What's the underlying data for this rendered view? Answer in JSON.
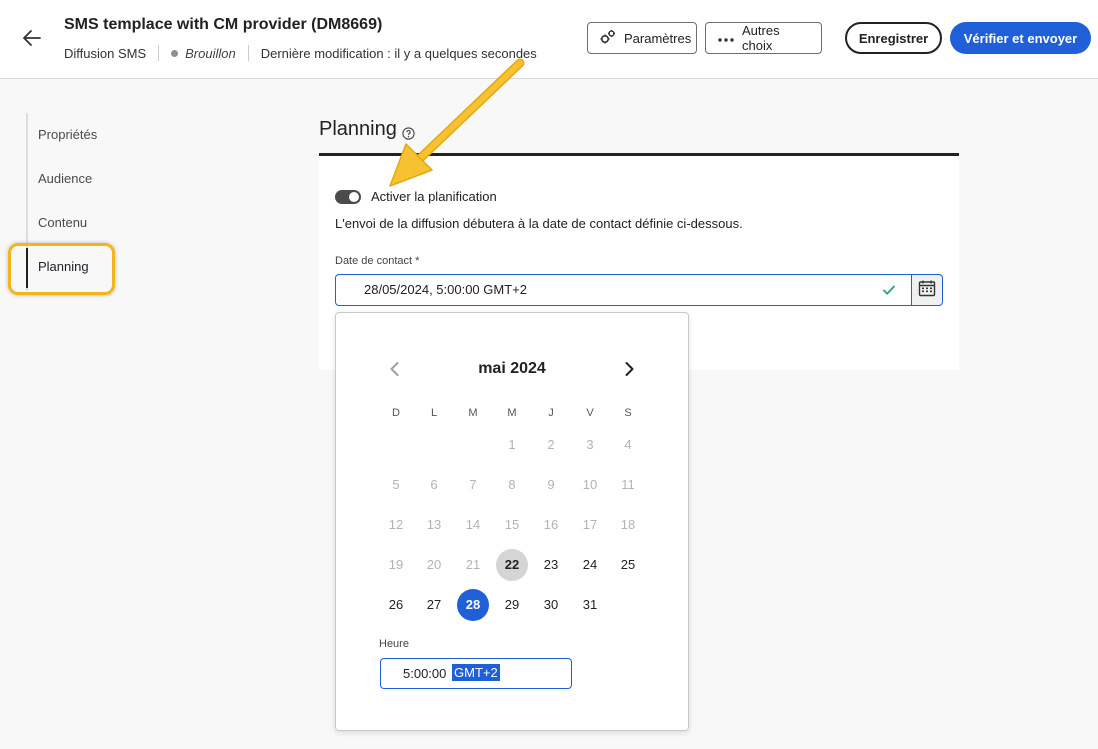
{
  "header": {
    "title": "SMS templace with CM provider (DM8669)",
    "channel": "Diffusion SMS",
    "status": "Brouillon",
    "last_modified": "Dernière modification : il y a quelques secondes",
    "params_label": "Paramètres",
    "more_label": "Autres choix",
    "save_label": "Enregistrer",
    "send_label": "Vérifier et envoyer"
  },
  "sidebar": {
    "items": [
      {
        "label": "Propriétés"
      },
      {
        "label": "Audience"
      },
      {
        "label": "Contenu"
      },
      {
        "label": "Planning",
        "active": true
      }
    ]
  },
  "planning": {
    "title": "Planning",
    "toggle_label": "Activer la planification",
    "toggle_on": true,
    "helptext": "L'envoi de la diffusion débutera à la date de contact définie ci-dessous.",
    "date_label": "Date de contact *",
    "date_value": "28/05/2024, 5:00:00 GMT+2"
  },
  "calendar": {
    "month_label": "mai 2024",
    "weekdays": [
      "D",
      "L",
      "M",
      "M",
      "J",
      "V",
      "S"
    ],
    "weeks": [
      [
        "",
        "",
        "",
        "1",
        "2",
        "3",
        "4"
      ],
      [
        "5",
        "6",
        "7",
        "8",
        "9",
        "10",
        "11"
      ],
      [
        "12",
        "13",
        "14",
        "15",
        "16",
        "17",
        "18"
      ],
      [
        "19",
        "20",
        "21",
        "22",
        "23",
        "24",
        "25"
      ],
      [
        "26",
        "27",
        "28",
        "29",
        "30",
        "31",
        ""
      ]
    ],
    "today": "22",
    "selected": "28",
    "first_enabled": "22",
    "time_label": "Heure",
    "time_value": "5:00:00",
    "timezone": "GMT+2"
  },
  "colors": {
    "accent": "#1f5fd8",
    "highlight": "#f2b61a"
  }
}
